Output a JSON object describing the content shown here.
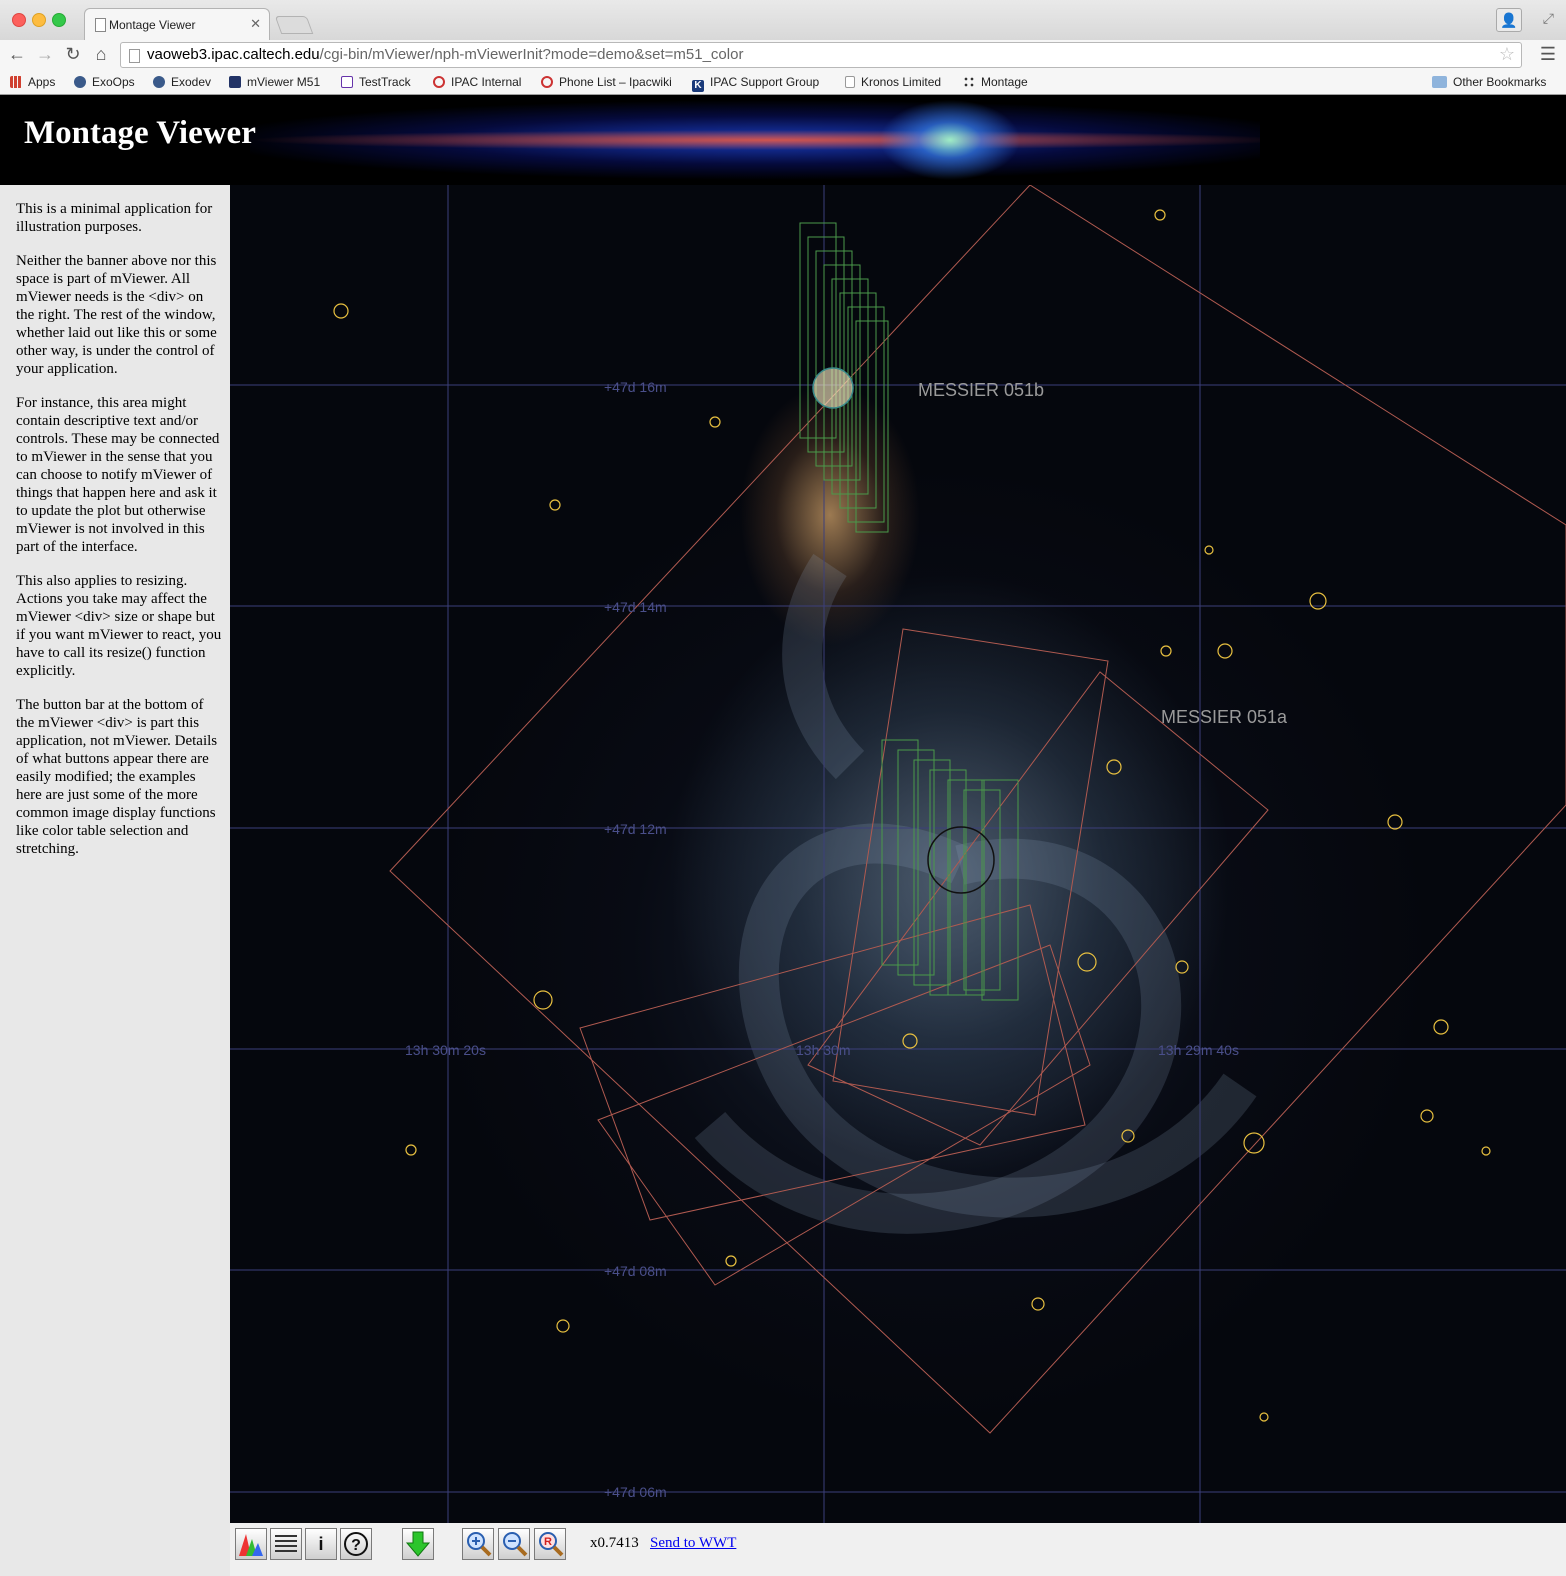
{
  "browser": {
    "tab_title": "Montage Viewer",
    "url_host": "vaoweb3.ipac.caltech.edu",
    "url_path": "/cgi-bin/mViewer/nph-mViewerInit?mode=demo&set=m51_color",
    "bookmarks": [
      {
        "label": "Apps",
        "icon": "apps-grid-icon",
        "color": "#d04030"
      },
      {
        "label": "ExoOps",
        "icon": "planet-icon",
        "color": "#3a5a8a"
      },
      {
        "label": "Exodev",
        "icon": "planet-icon",
        "color": "#3a5a8a"
      },
      {
        "label": "mViewer M51",
        "icon": "galaxy-icon",
        "color": "#223366"
      },
      {
        "label": "TestTrack",
        "icon": "testtrack-icon",
        "color": "#6633aa"
      },
      {
        "label": "IPAC Internal",
        "icon": "ipac-swirl-icon",
        "color": "#cc3333"
      },
      {
        "label": "Phone List – Ipacwiki",
        "icon": "ipac-swirl-icon",
        "color": "#cc3333"
      },
      {
        "label": "IPAC Support Group",
        "icon": "k-logo-icon",
        "color": "#1a3a7a"
      },
      {
        "label": "Kronos Limited",
        "icon": "document-icon",
        "color": "#ffffff"
      },
      {
        "label": "Montage",
        "icon": "montage-dots-icon",
        "color": "#333333"
      }
    ],
    "other_bookmarks": "Other Bookmarks"
  },
  "banner": {
    "title": "Montage Viewer"
  },
  "sidebar": {
    "paragraphs": [
      "This is a minimal application for illustration purposes.",
      "Neither the banner above nor this space is part of mViewer. All mViewer needs is the <div> on the right. The rest of the window, whether laid out like this or some other way, is under the control of your application.",
      "For instance, this area might contain descriptive text and/or controls. These may be connected to mViewer in the sense that you can choose to notify mViewer of things that happen here and ask it to update the plot but otherwise mViewer is not involved in this part of the interface.",
      "This also applies to resizing. Actions you take may affect the mViewer <div> size or shape but if you want mViewer to react, you have to call its resize() function explicitly.",
      "The button bar at the bottom of the mViewer <div> is part this application, not mViewer. Details of what buttons appear there are easily modified; the examples here are just some of the more common image display functions like color table selection and stretching."
    ]
  },
  "viewer": {
    "dec_labels": [
      "+47d 16m",
      "+47d 14m",
      "+47d 12m",
      "+47d 08m",
      "+47d 06m"
    ],
    "ra_labels": [
      "13h 30m 20s",
      "13h 30m",
      "13h 29m 40s"
    ],
    "objects": [
      "MESSIER 051b",
      "MESSIER 051a"
    ],
    "colors": {
      "grid": "#3c3f7a",
      "footprint_red": "#b05a50",
      "footprint_green": "#4a9a4a",
      "source_yellow": "#e8c040"
    }
  },
  "buttonbar": {
    "zoom": "x0.7413",
    "send_link": "Send to WWT",
    "buttons": [
      "color-table-icon",
      "layers-icon",
      "info-icon",
      "help-icon",
      "download-arrow-icon",
      "zoom-in-icon",
      "zoom-out-icon",
      "zoom-reset-icon"
    ]
  }
}
